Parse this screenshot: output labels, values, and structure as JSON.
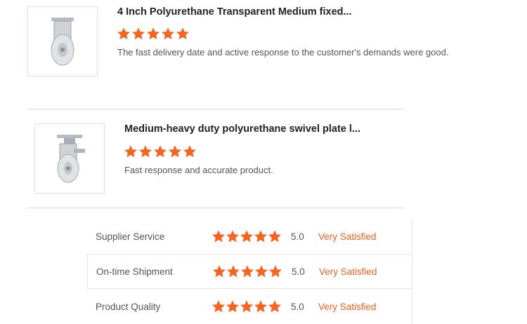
{
  "reviews": [
    {
      "title": "4 Inch Polyurethane Transparent Medium fixed...",
      "rating": 5,
      "comment": "The fast delivery date and active response to the customer's demands were good.",
      "image_icon": "fixed-caster-image"
    },
    {
      "title": "Medium-heavy duty polyurethane swivel plate l...",
      "rating": 5,
      "comment": "Fast response and accurate product.",
      "image_icon": "swivel-caster-image"
    }
  ],
  "ratings": [
    {
      "label": "Supplier Service",
      "stars": 5,
      "score": "5.0",
      "text": "Very Satisfied"
    },
    {
      "label": "On-time Shipment",
      "stars": 5,
      "score": "5.0",
      "text": "Very Satisfied"
    },
    {
      "label": "Product Quality",
      "stars": 5,
      "score": "5.0",
      "text": "Very Satisfied"
    }
  ],
  "colors": {
    "star": "#f26522",
    "accent_text": "#e8621f"
  }
}
